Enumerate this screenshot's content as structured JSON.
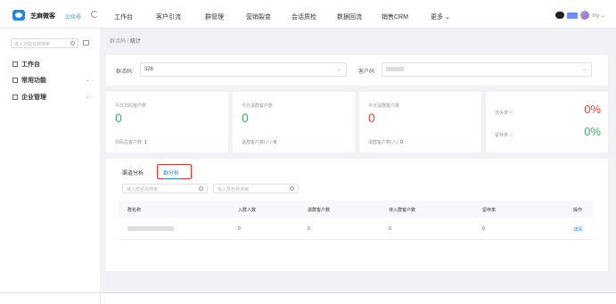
{
  "header": {
    "app_name": "芝麻微客",
    "account_type": "公众号",
    "nav": [
      "工作台",
      "客户引流",
      "群管理",
      "营销裂变",
      "会话质检",
      "数据回流",
      "销售CRM",
      "更多 ⌄"
    ],
    "user_name": "my ⌄"
  },
  "sidebar": {
    "search_placeholder": "输入功能名称搜索",
    "items": [
      {
        "label": "工作台",
        "icon": "monitor-icon"
      },
      {
        "label": "常用功能",
        "icon": "grid-icon",
        "arrow": "⌄"
      },
      {
        "label": "企业管理",
        "icon": "people-icon",
        "arrow": "⌄"
      }
    ]
  },
  "breadcrumb": {
    "parent": "群活码",
    "separator": "/",
    "current": "统计"
  },
  "filters": {
    "code_label": "群活码:",
    "code_value": "326",
    "ad_label": "客户码:",
    "chevron": "⌄"
  },
  "stats": [
    {
      "label": "今日扫码客户数",
      "value": "0",
      "foot_label": "扫码总客户数:",
      "foot_value": "1"
    },
    {
      "label": "今日退群客户数",
      "value": "0",
      "foot_label": "退群客户数(人):",
      "foot_value": "0"
    },
    {
      "label": "今日退群客户数",
      "value": "0",
      "foot_label": "退群客户数(人):",
      "foot_value": "0"
    }
  ],
  "rates": [
    {
      "label": "流失率 ⓘ",
      "value": "0%",
      "color": "#e74c3c"
    },
    {
      "label": "留存率 ⓘ",
      "value": "0%",
      "color": "#3ab262"
    }
  ],
  "tabs": [
    "渠道分析",
    "群分析"
  ],
  "searches": [
    "输入群名称搜索",
    "输入群名称搜索"
  ],
  "table": {
    "headers": [
      "群名称",
      "入群人数",
      "退群客户数",
      "待入群客户数",
      "留存率",
      "操作"
    ],
    "rows": [
      {
        "c1": "0",
        "c2": "0",
        "c3": "0",
        "c4": "0",
        "action": "详情"
      }
    ]
  },
  "colors": {
    "accent": "#1e88e5",
    "positive": "#3ab262",
    "negative": "#e74c3c",
    "highlight": "#d9342b"
  }
}
